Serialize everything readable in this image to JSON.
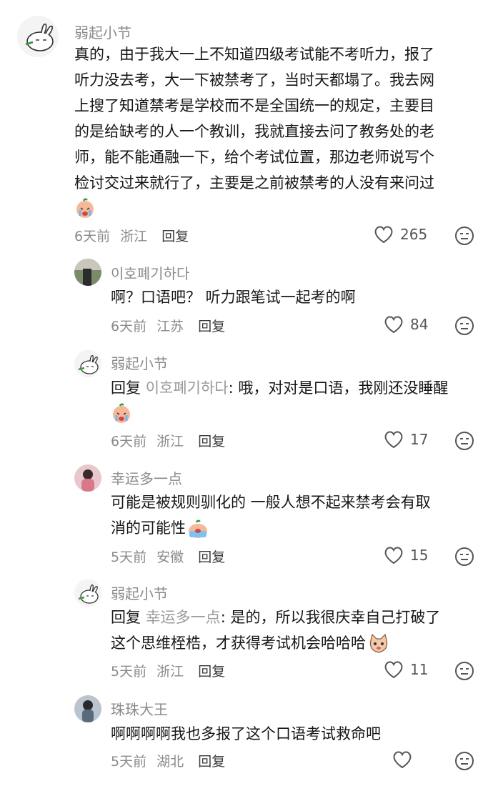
{
  "comments": [
    {
      "name": "弱起小节",
      "lines": [
        "真的，由于我大一上不知道四级考试能不考听力，报了",
        "听力没去考，大一下被禁考了，当时天都塌了。我去网",
        "上搜了知道禁考是学校而不是全国统一的规定，主要目",
        "的是给缺考的人一个教训，我就直接去问了教务处的老",
        "师，能不能通融一下，给个考试位置，那边老师说写个",
        "检讨交过来就行了，主要是之前被禁考的人没有来问过"
      ],
      "emoji": "crying-face-emoji",
      "time": "6天前",
      "location": "浙江",
      "reply_label": "回复",
      "likes": "265"
    },
    {
      "name": "이호폐기하다",
      "lines": [
        "啊？口语吧？ 听力跟笔试一起考的啊"
      ],
      "time": "6天前",
      "location": "江苏",
      "reply_label": "回复",
      "likes": "84"
    },
    {
      "name": "弱起小节",
      "reply_prefix": "回复",
      "reply_target": "이호폐기하다",
      "text": ": 哦，对对是口语，我刚还没睡醒",
      "emoji": "crying-face-emoji",
      "time": "6天前",
      "location": "浙江",
      "reply_label": "回复",
      "likes": "17"
    },
    {
      "name": "幸运多一点",
      "lines": [
        "可能是被规则驯化的 一般人想不起来禁考会有取",
        "消的可能性"
      ],
      "emoji": "sobbing-emoji",
      "time": "5天前",
      "location": "安徽",
      "reply_label": "回复",
      "likes": "15"
    },
    {
      "name": "弱起小节",
      "reply_prefix": "回复",
      "reply_target": "幸运多一点",
      "text": ": 是的，所以我很庆幸自己打破了",
      "line2": "这个思维桎梏，才获得考试机会哈哈哈",
      "emoji": "cat-face-emoji",
      "time": "5天前",
      "location": "浙江",
      "reply_label": "回复",
      "likes": "11"
    },
    {
      "name": "珠珠大王",
      "lines": [
        "啊啊啊啊我也多报了这个口语考试救命吧"
      ],
      "time": "5天前",
      "location": "湖北",
      "reply_label": "回复",
      "likes": ""
    }
  ],
  "colors": {
    "username": "#8a8a8a",
    "reply_target": "#9a9a9a",
    "meta": "#8a8a8a"
  }
}
